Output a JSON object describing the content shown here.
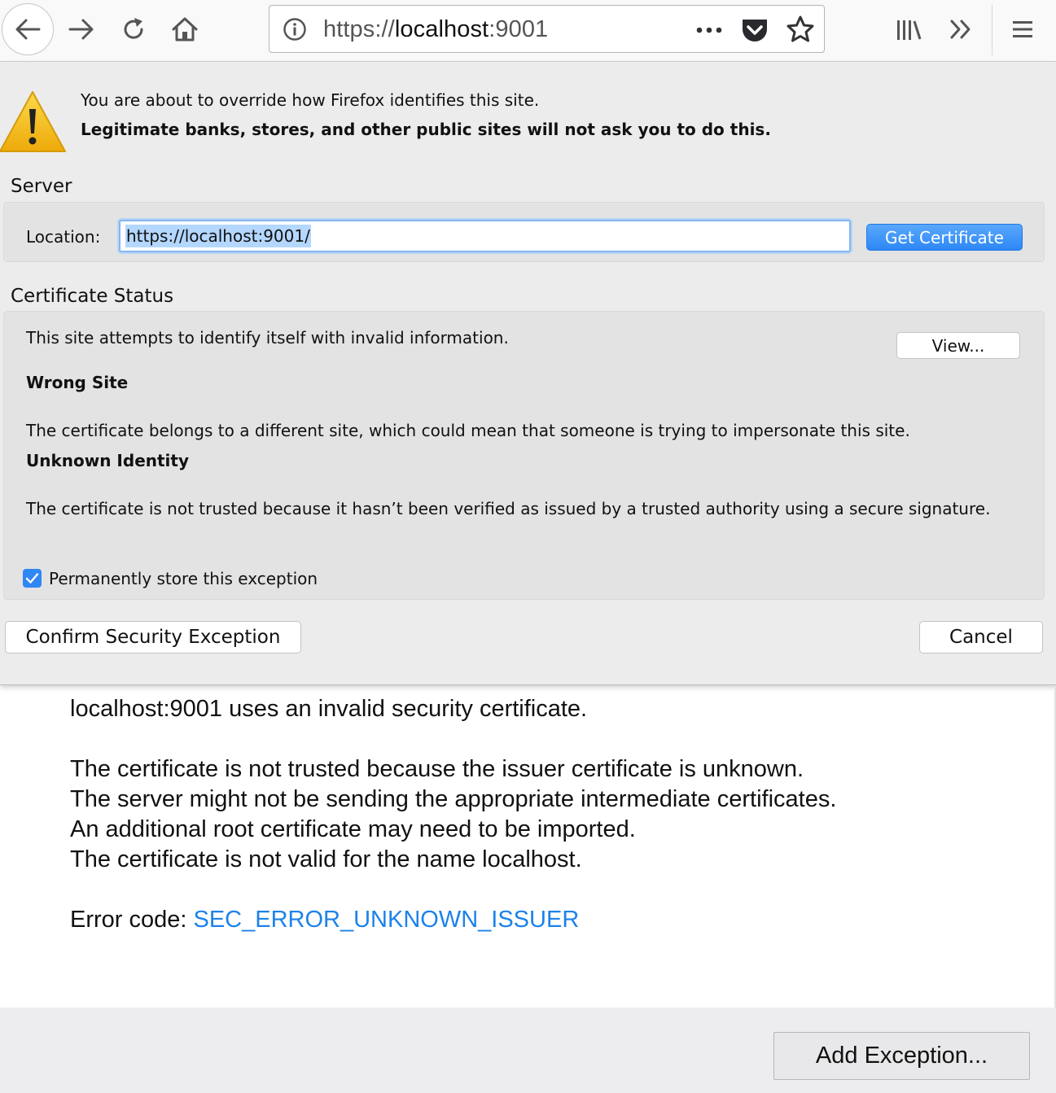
{
  "toolbar": {
    "url_prefix": "https://",
    "url_host": "localhost",
    "url_suffix": ":9001",
    "icons": [
      "back-icon",
      "forward-icon",
      "reload-icon",
      "home-icon",
      "info-icon",
      "page-actions-icon",
      "pocket-icon",
      "bookmark-star-icon",
      "library-icon",
      "overflow-icon",
      "menu-icon"
    ]
  },
  "dialog": {
    "warning_line1": "You are about to override how Firefox identifies this site.",
    "warning_line2": "Legitimate banks, stores, and other public sites will not ask you to do this.",
    "server_title": "Server",
    "location_label": "Location:",
    "location_value": "https://localhost:9001/",
    "get_certificate_label": "Get Certificate",
    "status_title": "Certificate Status",
    "status_line": "This site attempts to identify itself with invalid information.",
    "view_label": "View...",
    "wrong_site_title": "Wrong Site",
    "wrong_site_desc": "The certificate belongs to a different site, which could mean that someone is trying to impersonate this site.",
    "unknown_identity_title": "Unknown Identity",
    "unknown_identity_desc": "The certificate is not trusted because it hasn’t been verified as issued by a trusted authority using a secure signature.",
    "store_exception_label": "Permanently store this exception",
    "store_exception_checked": true,
    "confirm_label": "Confirm Security Exception",
    "cancel_label": "Cancel"
  },
  "error_page": {
    "title": "localhost:9001 uses an invalid security certificate.",
    "details": [
      "The certificate is not trusted because the issuer certificate is unknown.",
      "The server might not be sending the appropriate intermediate certificates.",
      "An additional root certificate may need to be imported.",
      "The certificate is not valid for the name localhost."
    ],
    "error_code_label": "Error code: ",
    "error_code": "SEC_ERROR_UNKNOWN_ISSUER",
    "add_exception_label": "Add Exception..."
  },
  "colors": {
    "accent_blue": "#2d87f5",
    "link_blue": "#1d82ea",
    "warning_yellow": "#f6c21c"
  }
}
